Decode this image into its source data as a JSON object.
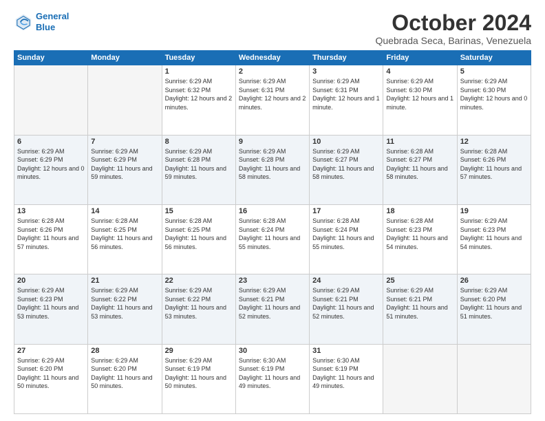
{
  "logo": {
    "line1": "General",
    "line2": "Blue"
  },
  "title": "October 2024",
  "subtitle": "Quebrada Seca, Barinas, Venezuela",
  "headers": [
    "Sunday",
    "Monday",
    "Tuesday",
    "Wednesday",
    "Thursday",
    "Friday",
    "Saturday"
  ],
  "weeks": [
    [
      {
        "day": "",
        "text": ""
      },
      {
        "day": "",
        "text": ""
      },
      {
        "day": "1",
        "text": "Sunrise: 6:29 AM\nSunset: 6:32 PM\nDaylight: 12 hours\nand 2 minutes."
      },
      {
        "day": "2",
        "text": "Sunrise: 6:29 AM\nSunset: 6:31 PM\nDaylight: 12 hours\nand 2 minutes."
      },
      {
        "day": "3",
        "text": "Sunrise: 6:29 AM\nSunset: 6:31 PM\nDaylight: 12 hours\nand 1 minute."
      },
      {
        "day": "4",
        "text": "Sunrise: 6:29 AM\nSunset: 6:30 PM\nDaylight: 12 hours\nand 1 minute."
      },
      {
        "day": "5",
        "text": "Sunrise: 6:29 AM\nSunset: 6:30 PM\nDaylight: 12 hours\nand 0 minutes."
      }
    ],
    [
      {
        "day": "6",
        "text": "Sunrise: 6:29 AM\nSunset: 6:29 PM\nDaylight: 12 hours\nand 0 minutes."
      },
      {
        "day": "7",
        "text": "Sunrise: 6:29 AM\nSunset: 6:29 PM\nDaylight: 11 hours\nand 59 minutes."
      },
      {
        "day": "8",
        "text": "Sunrise: 6:29 AM\nSunset: 6:28 PM\nDaylight: 11 hours\nand 59 minutes."
      },
      {
        "day": "9",
        "text": "Sunrise: 6:29 AM\nSunset: 6:28 PM\nDaylight: 11 hours\nand 58 minutes."
      },
      {
        "day": "10",
        "text": "Sunrise: 6:29 AM\nSunset: 6:27 PM\nDaylight: 11 hours\nand 58 minutes."
      },
      {
        "day": "11",
        "text": "Sunrise: 6:28 AM\nSunset: 6:27 PM\nDaylight: 11 hours\nand 58 minutes."
      },
      {
        "day": "12",
        "text": "Sunrise: 6:28 AM\nSunset: 6:26 PM\nDaylight: 11 hours\nand 57 minutes."
      }
    ],
    [
      {
        "day": "13",
        "text": "Sunrise: 6:28 AM\nSunset: 6:26 PM\nDaylight: 11 hours\nand 57 minutes."
      },
      {
        "day": "14",
        "text": "Sunrise: 6:28 AM\nSunset: 6:25 PM\nDaylight: 11 hours\nand 56 minutes."
      },
      {
        "day": "15",
        "text": "Sunrise: 6:28 AM\nSunset: 6:25 PM\nDaylight: 11 hours\nand 56 minutes."
      },
      {
        "day": "16",
        "text": "Sunrise: 6:28 AM\nSunset: 6:24 PM\nDaylight: 11 hours\nand 55 minutes."
      },
      {
        "day": "17",
        "text": "Sunrise: 6:28 AM\nSunset: 6:24 PM\nDaylight: 11 hours\nand 55 minutes."
      },
      {
        "day": "18",
        "text": "Sunrise: 6:28 AM\nSunset: 6:23 PM\nDaylight: 11 hours\nand 54 minutes."
      },
      {
        "day": "19",
        "text": "Sunrise: 6:29 AM\nSunset: 6:23 PM\nDaylight: 11 hours\nand 54 minutes."
      }
    ],
    [
      {
        "day": "20",
        "text": "Sunrise: 6:29 AM\nSunset: 6:23 PM\nDaylight: 11 hours\nand 53 minutes."
      },
      {
        "day": "21",
        "text": "Sunrise: 6:29 AM\nSunset: 6:22 PM\nDaylight: 11 hours\nand 53 minutes."
      },
      {
        "day": "22",
        "text": "Sunrise: 6:29 AM\nSunset: 6:22 PM\nDaylight: 11 hours\nand 53 minutes."
      },
      {
        "day": "23",
        "text": "Sunrise: 6:29 AM\nSunset: 6:21 PM\nDaylight: 11 hours\nand 52 minutes."
      },
      {
        "day": "24",
        "text": "Sunrise: 6:29 AM\nSunset: 6:21 PM\nDaylight: 11 hours\nand 52 minutes."
      },
      {
        "day": "25",
        "text": "Sunrise: 6:29 AM\nSunset: 6:21 PM\nDaylight: 11 hours\nand 51 minutes."
      },
      {
        "day": "26",
        "text": "Sunrise: 6:29 AM\nSunset: 6:20 PM\nDaylight: 11 hours\nand 51 minutes."
      }
    ],
    [
      {
        "day": "27",
        "text": "Sunrise: 6:29 AM\nSunset: 6:20 PM\nDaylight: 11 hours\nand 50 minutes."
      },
      {
        "day": "28",
        "text": "Sunrise: 6:29 AM\nSunset: 6:20 PM\nDaylight: 11 hours\nand 50 minutes."
      },
      {
        "day": "29",
        "text": "Sunrise: 6:29 AM\nSunset: 6:19 PM\nDaylight: 11 hours\nand 50 minutes."
      },
      {
        "day": "30",
        "text": "Sunrise: 6:30 AM\nSunset: 6:19 PM\nDaylight: 11 hours\nand 49 minutes."
      },
      {
        "day": "31",
        "text": "Sunrise: 6:30 AM\nSunset: 6:19 PM\nDaylight: 11 hours\nand 49 minutes."
      },
      {
        "day": "",
        "text": ""
      },
      {
        "day": "",
        "text": ""
      }
    ]
  ]
}
